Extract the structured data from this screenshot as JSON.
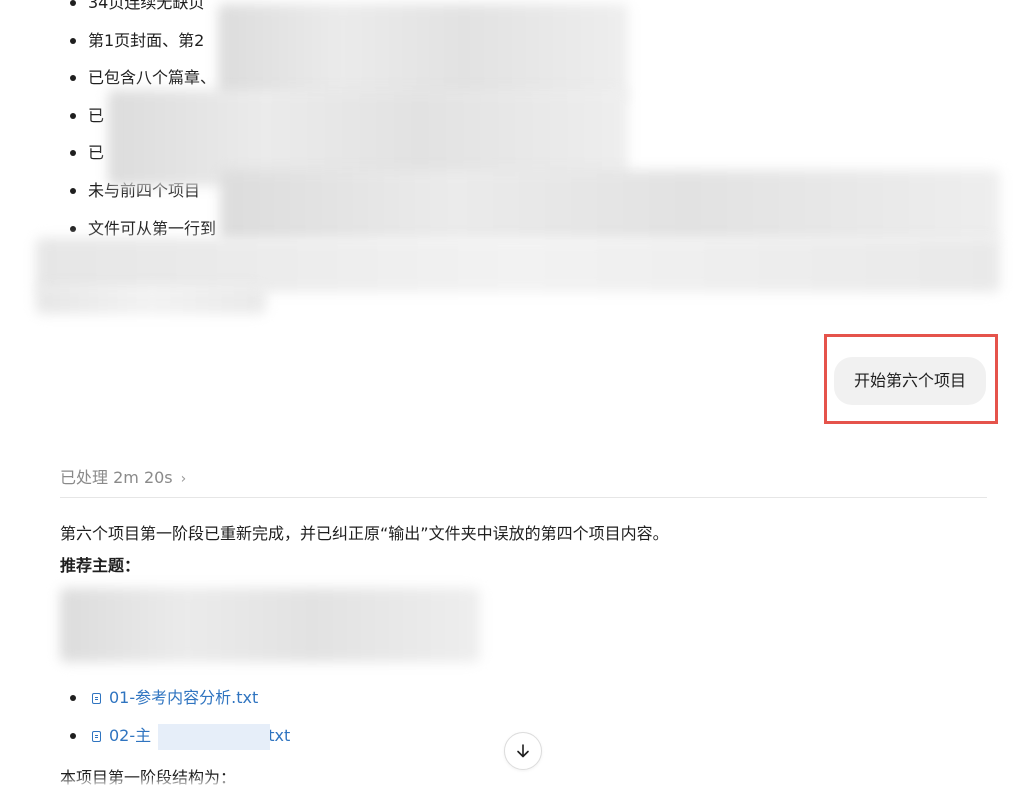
{
  "previous_response": {
    "bullets": [
      "34页连续无缺页",
      "第1页封面、第2",
      "已包含八个篇章、",
      "已",
      "已",
      "未与前四个项目",
      "文件可从第一行到"
    ]
  },
  "user_message": {
    "text": "开始第六个项目"
  },
  "assistant": {
    "processed_label": "已处理 2m 20s",
    "processed_chevron": "›",
    "summary": "第六个项目第一阶段已重新完成，并已纠正原“输出”文件夹中误放的第四个项目内容。",
    "recommended_topic_label": "推荐主题：",
    "files": [
      {
        "name": "01-参考内容分析.txt",
        "icon": "document-icon"
      },
      {
        "name": "02-主",
        "suffix": ".txt",
        "icon": "document-icon"
      }
    ],
    "structure_label": "本项目第一阶段结构为："
  },
  "scroll_button": {
    "icon": "arrow-down-icon"
  },
  "colors": {
    "highlight_border": "#e5534b",
    "link": "#2f74c0",
    "bubble_bg": "#f1f1f1",
    "muted_text": "#8a8a8a"
  }
}
